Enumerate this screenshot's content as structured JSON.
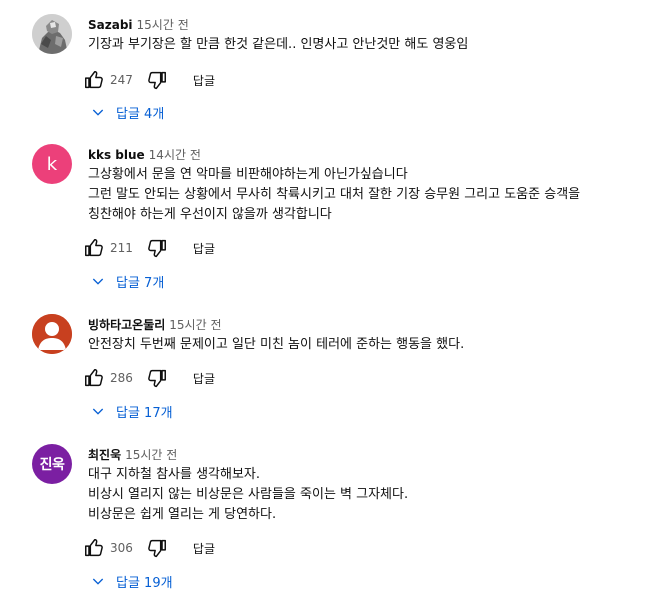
{
  "comments": [
    {
      "author": "Sazabi",
      "time": "15시간 전",
      "avatar": {
        "type": "image",
        "icon": "figure-portrait-icon",
        "bg": "#d9d9d9"
      },
      "lines": [
        "기장과 부기장은 할 만큼 한것 같은데.. 인명사고 안난것만 해도 영웅임"
      ],
      "likes": "247",
      "reply_label": "답글",
      "replies_label": "답글 4개"
    },
    {
      "author": "kks blue",
      "time": "14시간 전",
      "avatar": {
        "type": "letter",
        "text": "k",
        "bg": "#ec407a"
      },
      "lines": [
        "그상황에서 문을 연 악마를 비판해야하는게 아닌가싶습니다",
        "그런 말도 안되는 상황에서 무사히 착륙시키고 대처 잘한 기장 승무원 그리고 도움준 승객을",
        "칭찬해야 하는게 우선이지 않을까 생각합니다"
      ],
      "likes": "211",
      "reply_label": "답글",
      "replies_label": "답글 7개"
    },
    {
      "author": "빙하타고온둘리",
      "time": "15시간 전",
      "avatar": {
        "type": "default",
        "icon": "default-user-icon",
        "bg": "#c8401f"
      },
      "lines": [
        "안전장치 두번째 문제이고 일단 미친 놈이 테러에 준하는 행동을 했다."
      ],
      "likes": "286",
      "reply_label": "답글",
      "replies_label": "답글 17개"
    },
    {
      "author": "최진욱",
      "time": "15시간 전",
      "avatar": {
        "type": "text",
        "text": "진욱",
        "bg": "#7b1fa2"
      },
      "lines": [
        "대구 지하철 참사를 생각해보자.",
        "비상시 열리지 않는 비상문은 사람들을 죽이는 벽 그자체다.",
        "비상문은 쉽게 열리는 게 당연하다."
      ],
      "likes": "306",
      "reply_label": "답글",
      "replies_label": "답글 19개"
    }
  ],
  "icons": {
    "like": "thumbs-up-icon",
    "dislike": "thumbs-down-icon",
    "expand": "chevron-down-icon"
  },
  "colors": {
    "link": "#065fd4",
    "secondary_text": "#606060"
  }
}
